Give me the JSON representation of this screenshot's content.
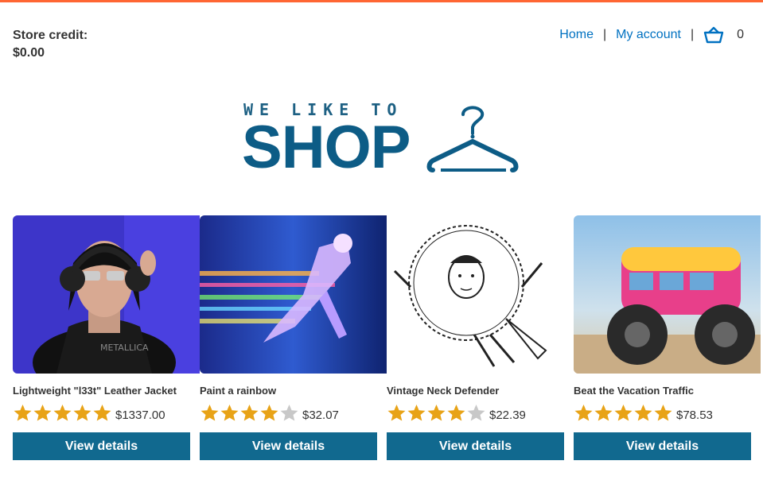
{
  "header": {
    "credit_label": "Store credit:",
    "credit_value": "$0.00",
    "nav": {
      "home": "Home",
      "separator": "|",
      "account": "My account",
      "cart_icon": "basket-icon",
      "cart_count": "0"
    }
  },
  "logo": {
    "tagline": "WE LIKE TO",
    "wordmark": "SHOP",
    "icon": "clothes-hanger-icon"
  },
  "colors": {
    "accent": "#ff6633",
    "brand": "#0d5c86",
    "button": "#11698f",
    "link": "#0071c1",
    "star_on": "#e8a317",
    "star_off": "#c8c8c8"
  },
  "products": [
    {
      "name": "Lightweight \"l33t\" Leather Jacket",
      "rating": 5,
      "price": "$1337.00",
      "button": "View details",
      "image": "woman-with-headphones-photo"
    },
    {
      "name": "Paint a rainbow",
      "rating": 4,
      "price": "$32.07",
      "button": "View details",
      "image": "rainbow-runner-photo"
    },
    {
      "name": "Vintage Neck Defender",
      "rating": 4,
      "price": "$22.39",
      "button": "View details",
      "image": "neck-ruff-illustration"
    },
    {
      "name": "Beat the Vacation Traffic",
      "rating": 5,
      "price": "$78.53",
      "button": "View details",
      "image": "monster-van-photo"
    }
  ]
}
